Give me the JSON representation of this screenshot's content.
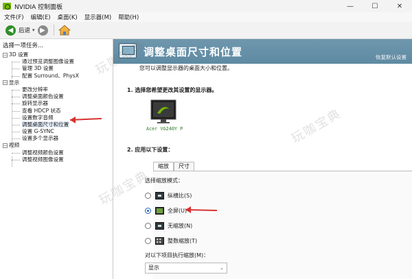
{
  "window": {
    "title": "NVIDIA 控制面板",
    "controls": {
      "minimize": "—",
      "maximize": "☐",
      "close": "✕"
    }
  },
  "menu": [
    "文件(F)",
    "编辑(E)",
    "桌面(K)",
    "显示器(M)",
    "帮助(H)"
  ],
  "toolbar": {
    "back_label": "后退",
    "dropdown": "▾",
    "back_icon": "arrow-left-icon",
    "forward_icon": "arrow-right-icon",
    "home_icon": "home-icon"
  },
  "left_pane": {
    "title": "选择一项任务...",
    "tree": [
      {
        "type": "cat",
        "label": "3D 设置",
        "expander": "⊟"
      },
      {
        "type": "item",
        "label": "通过预览调整图像设置"
      },
      {
        "type": "item",
        "label": "管理 3D 设置"
      },
      {
        "type": "item",
        "label": "配置 Surround、PhysX"
      },
      {
        "type": "cat",
        "label": "显示",
        "expander": "⊟"
      },
      {
        "type": "item",
        "label": "更改分辨率"
      },
      {
        "type": "item",
        "label": "调整桌面颜色设置"
      },
      {
        "type": "item",
        "label": "旋转显示器"
      },
      {
        "type": "item",
        "label": "查看 HDCP 状态"
      },
      {
        "type": "item",
        "label": "设置数字音频"
      },
      {
        "type": "item",
        "label": "调整桌面尺寸和位置",
        "selected": true
      },
      {
        "type": "item",
        "label": "设置 G-SYNC"
      },
      {
        "type": "item",
        "label": "设置多个显示器"
      },
      {
        "type": "cat",
        "label": "视频",
        "expander": "⊟"
      },
      {
        "type": "item",
        "label": "调整视频颜色设置"
      },
      {
        "type": "item",
        "label": "调整视频图像设置"
      }
    ]
  },
  "main": {
    "header_title": "调整桌面尺寸和位置",
    "restore_defaults": "恢复默认设置",
    "description": "您可以调整显示器的桌面大小和位置。",
    "section1": "1. 选择您希望更改其设置的显示器。",
    "monitor_label": "Acer VG240Y P",
    "section2": "2. 应用以下设置：",
    "tabs": [
      "缩放",
      "尺寸"
    ],
    "active_tab": 0,
    "scaling_mode_label": "选择缩放模式：",
    "options": [
      {
        "label": "纵横比(S)",
        "selected": false,
        "icon": "aspect-ratio-icon"
      },
      {
        "label": "全屏(U)",
        "selected": true,
        "icon": "fullscreen-icon"
      },
      {
        "label": "无缩放(N)",
        "selected": false,
        "icon": "no-scaling-icon"
      },
      {
        "label": "整数缩放(T)",
        "selected": false,
        "icon": "integer-scaling-icon"
      }
    ],
    "perform_on_label": "对以下项目执行缩放(M)：",
    "perform_on_value": "显示"
  },
  "watermark": "玩咖宝典",
  "colors": {
    "header": "#6a93aa",
    "nvidia_green": "#76b900",
    "annotation_arrow": "#d93030",
    "selected_radio": "#1f5fbf"
  }
}
